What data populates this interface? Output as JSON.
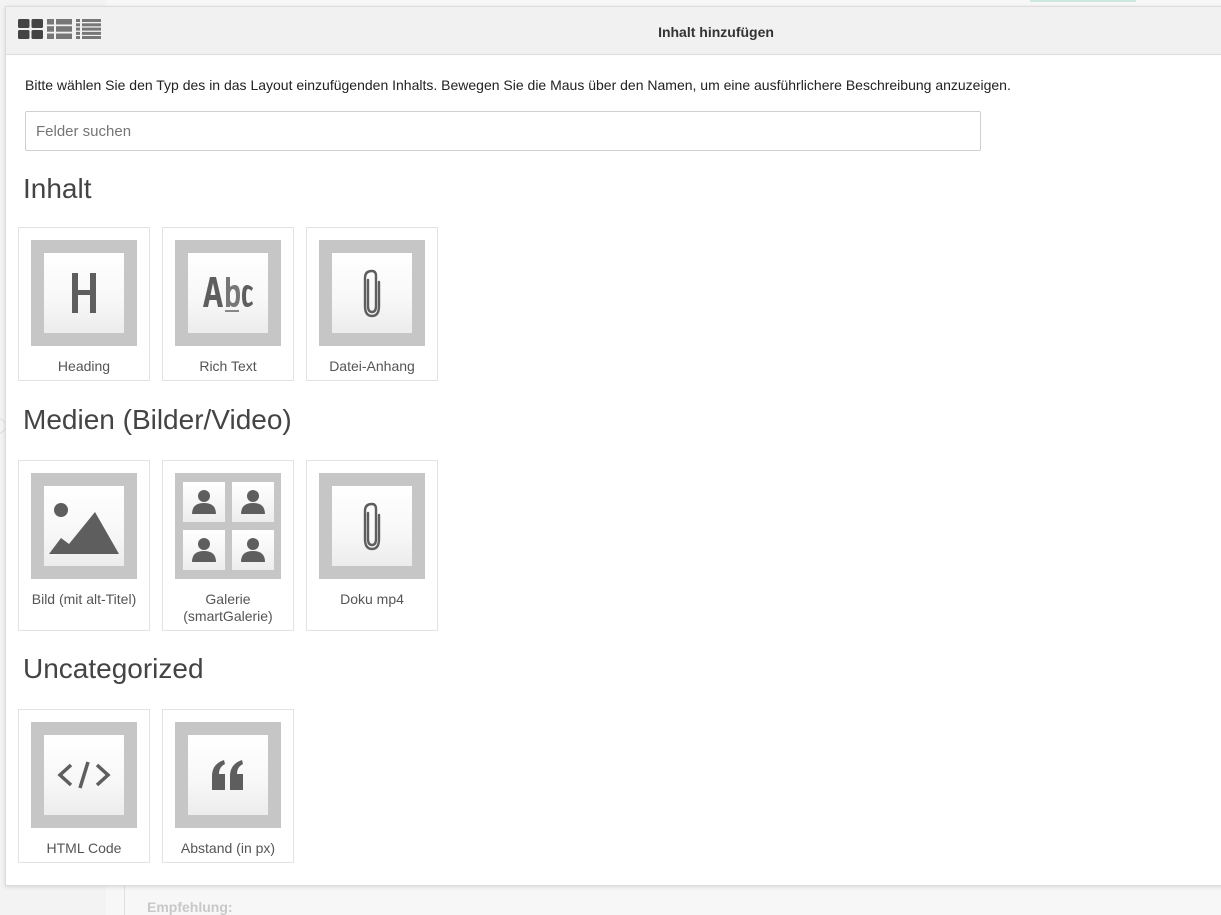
{
  "dialog": {
    "title": "Inhalt hinzufügen",
    "intro": "Bitte wählen Sie den Typ des in das Layout einzufügenden Inhalts. Bewegen Sie die Maus über den Namen, um eine ausführlichere Beschreibung anzuzeigen.",
    "search_placeholder": "Felder suchen",
    "view_modes": [
      "grid-view-icon",
      "list-view-icon",
      "compact-list-icon"
    ]
  },
  "sections": [
    {
      "title": "Inhalt",
      "items": [
        {
          "label": "Heading",
          "icon": "heading-icon"
        },
        {
          "label": "Rich Text",
          "icon": "rich-text-icon"
        },
        {
          "label": "Datei-Anhang",
          "icon": "paperclip-icon"
        }
      ]
    },
    {
      "title": "Medien (Bilder/Video)",
      "items": [
        {
          "label": "Bild (mit alt-Titel)",
          "icon": "image-icon"
        },
        {
          "label": "Galerie (smartGalerie)",
          "icon": "gallery-icon"
        },
        {
          "label": "Doku mp4",
          "icon": "paperclip-icon"
        }
      ]
    },
    {
      "title": "Uncategorized",
      "items": [
        {
          "label": "HTML Code",
          "icon": "code-icon"
        },
        {
          "label": "Abstand (in px)",
          "icon": "quote-icon"
        }
      ]
    }
  ],
  "background": {
    "label": "Empfehlung:"
  },
  "colors": {
    "thumb_frame": "#c6c6c6",
    "icon": "#666666",
    "header_bg": "#f1f1f1"
  }
}
